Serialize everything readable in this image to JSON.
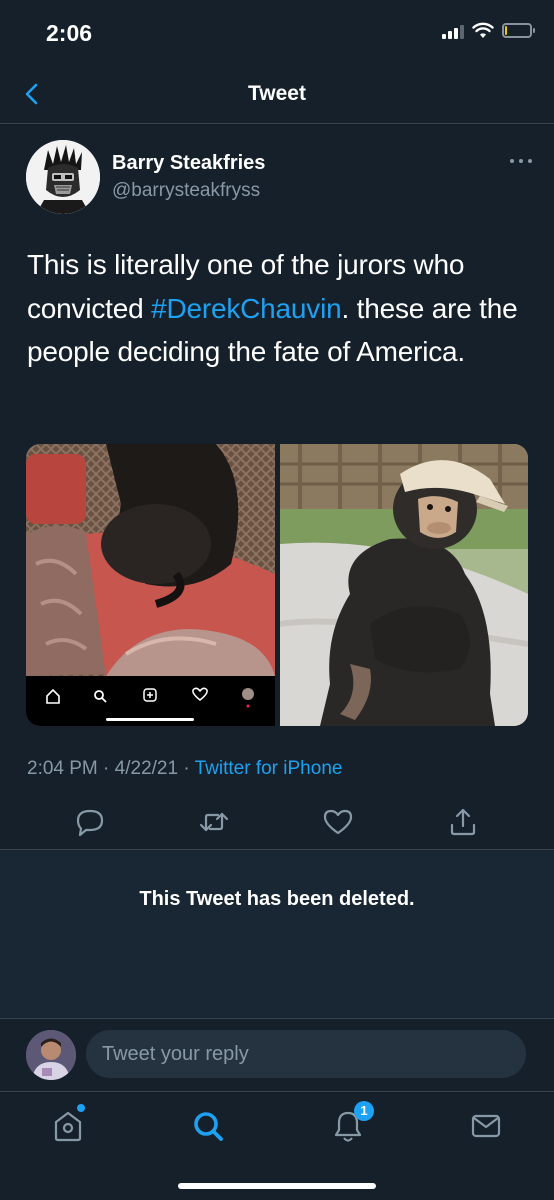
{
  "status_bar": {
    "time": "2:06",
    "signal_bars": 4,
    "signal_active": 3,
    "battery_level": 0.08,
    "icons": [
      "signal-icon",
      "wifi-icon",
      "battery-icon"
    ]
  },
  "nav": {
    "title": "Tweet",
    "back_icon": "chevron-left-icon"
  },
  "tweet": {
    "author": {
      "name": "Barry Steakfries",
      "handle": "@barrysteakfryss"
    },
    "text_before": "This is literally one of the jurors who convicted ",
    "hashtag": "#DerekChauvin",
    "text_after": ". these are the people deciding the fate of America.",
    "time": "2:04 PM",
    "separator": "·",
    "date": "4/22/21",
    "source": "Twitter for iPhone",
    "actions": [
      "reply-icon",
      "retweet-icon",
      "like-icon",
      "share-icon"
    ],
    "media": [
      {
        "name": "photo-chimp-on-couch",
        "embedded_tabs": [
          "home-icon",
          "search-icon",
          "add-icon",
          "heart-icon",
          "profile-icon"
        ]
      },
      {
        "name": "photo-chimp-in-cap"
      }
    ]
  },
  "deleted_notice": "This Tweet has been deleted.",
  "reply": {
    "placeholder": "Tweet your reply"
  },
  "tab_bar": {
    "items": [
      "home-icon",
      "search-icon",
      "notifications-icon",
      "messages-icon"
    ],
    "notifications_count": "1"
  },
  "colors": {
    "background": "#15202b",
    "deleted_background": "#192734",
    "accent": "#1da1f2",
    "secondary_text": "#8899a6",
    "divider": "#38444d"
  }
}
